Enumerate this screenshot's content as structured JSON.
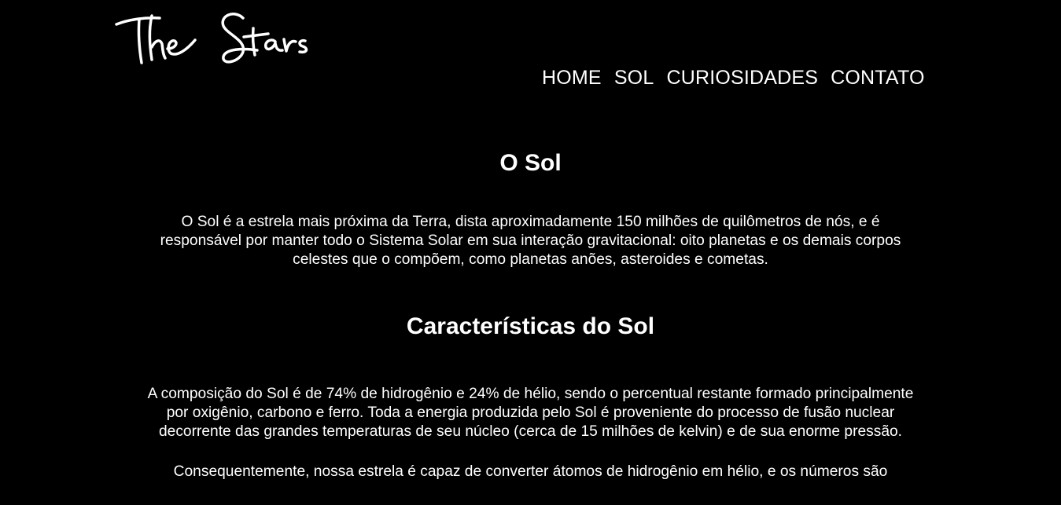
{
  "header": {
    "logo_text": "The Stars",
    "nav": [
      {
        "label": "HOME"
      },
      {
        "label": "SOL"
      },
      {
        "label": "CURIOSIDADES"
      },
      {
        "label": "CONTATO"
      }
    ]
  },
  "main": {
    "title": "O Sol",
    "intro": "O Sol é a estrela mais próxima da Terra, dista aproximadamente 150 milhões de quilômetros de nós, e é responsável por manter todo o Sistema Solar em sua interação gravitacional: oito planetas e os demais corpos celestes que o compõem, como planetas anões, asteroides e cometas.",
    "section_title": "Características do Sol",
    "composition": "A composição do Sol é de 74% de hidrogênio e 24% de hélio, sendo o percentual restante formado principalmente por oxigênio, carbono e ferro. Toda a energia produzida pelo Sol é proveniente do processo de fusão nuclear decorrente das grandes temperaturas de seu núcleo (cerca de 15 milhões de kelvin) e de sua enorme pressão.",
    "consequence": "Consequentemente, nossa estrela é capaz de converter átomos de hidrogênio em hélio, e os números são"
  }
}
